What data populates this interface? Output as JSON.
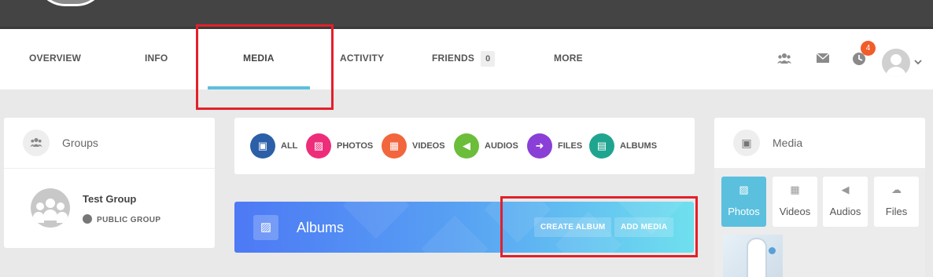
{
  "nav": {
    "tabs": [
      {
        "label": "OVERVIEW"
      },
      {
        "label": "INFO"
      },
      {
        "label": "MEDIA",
        "active": true
      },
      {
        "label": "ACTIVITY"
      },
      {
        "label": "FRIENDS",
        "count": "0"
      },
      {
        "label": "MORE"
      }
    ],
    "notifications_count": "4"
  },
  "groups_panel": {
    "title": "Groups",
    "items": [
      {
        "name": "Test Group",
        "type": "PUBLIC GROUP"
      }
    ]
  },
  "media_filters": [
    {
      "label": "ALL",
      "color": "#2c5fa8",
      "icon": "all-media-icon"
    },
    {
      "label": "PHOTOS",
      "color": "#ee2d7a",
      "icon": "photo-icon"
    },
    {
      "label": "VIDEOS",
      "color": "#f2663d",
      "icon": "video-icon"
    },
    {
      "label": "AUDIOS",
      "color": "#6cbd3a",
      "icon": "audio-icon"
    },
    {
      "label": "FILES",
      "color": "#8a3fd6",
      "icon": "file-icon"
    },
    {
      "label": "ALBUMS",
      "color": "#1fa58f",
      "icon": "album-icon"
    }
  ],
  "albums_banner": {
    "title": "Albums",
    "create_album_label": "CREATE ALBUM",
    "add_media_label": "ADD MEDIA"
  },
  "media_panel": {
    "title": "Media",
    "tabs": [
      {
        "label": "Photos",
        "active": true
      },
      {
        "label": "Videos"
      },
      {
        "label": "Audios"
      },
      {
        "label": "Files"
      }
    ]
  },
  "colors": {
    "accent": "#5bc0de",
    "highlight_box": "#e3202a",
    "notification_badge": "#f25c2a"
  }
}
